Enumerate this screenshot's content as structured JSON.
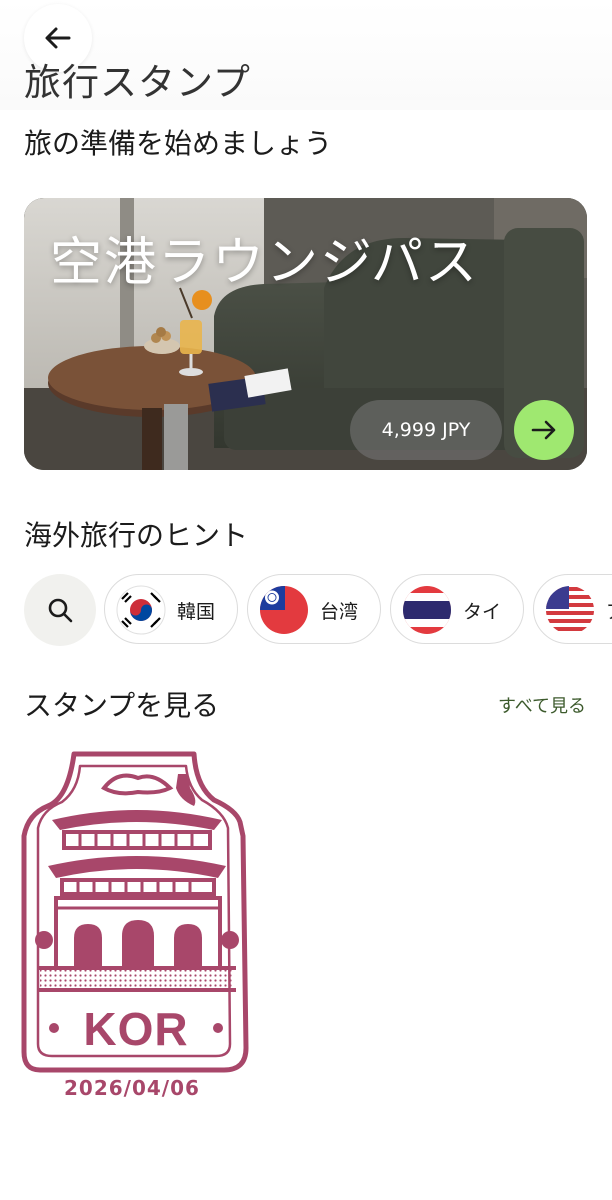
{
  "header": {
    "title": "旅行スタンプ",
    "back_icon": "arrow-left-icon"
  },
  "prep_section": {
    "title": "旅の準備を始めましょう"
  },
  "banner": {
    "title": "空港ラウンジパス",
    "price": "4,999 JPY",
    "go_icon": "arrow-right-icon",
    "accent_color": "#9fe870"
  },
  "tips_section": {
    "title": "海外旅行のヒント",
    "search_icon": "search-icon",
    "countries": [
      {
        "label": "韓国",
        "flag": "kr-flag-icon"
      },
      {
        "label": "台湾",
        "flag": "tw-flag-icon"
      },
      {
        "label": "タイ",
        "flag": "th-flag-icon"
      },
      {
        "label": "ア",
        "flag": "us-flag-icon"
      }
    ]
  },
  "stamps_section": {
    "title": "スタンプを見る",
    "see_all": "すべて見る",
    "stamps": [
      {
        "code": "KOR",
        "date": "2026/04/06",
        "color": "#a8476a"
      }
    ]
  }
}
